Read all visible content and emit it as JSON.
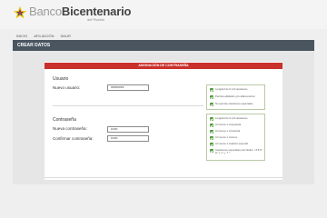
{
  "brand": {
    "name_light": "Banco",
    "name_bold": "Bicentenario",
    "tagline": "del Pueblo",
    "colors": {
      "star_yellow": "#f3c300",
      "star_blue": "#1f4f9a",
      "star_red": "#d32f2f"
    }
  },
  "nav": {
    "items": [
      "INICIO",
      "AFILIACIÓN",
      "SALIR"
    ]
  },
  "header": {
    "title": "CREAR DATOS"
  },
  "panel": {
    "title": "ASIGNACIÓN DE CONTRASEÑA",
    "accent_color": "#c9302c"
  },
  "usuario": {
    "section_title": "Usuario",
    "field_label": "Nuevo usuario:",
    "field_value": "xxxxxxxx",
    "rules": [
      "Longitud de 6 a 8 caracteres",
      "Permite alfabético y/o alfanumérico",
      "No permite caracteres especiales"
    ]
  },
  "contrasena": {
    "section_title": "Contraseña",
    "new_label": "Nueva contraseña:",
    "new_value": "••••••",
    "confirm_label": "Confirmar contraseña:",
    "confirm_value": "••••••",
    "rules": [
      "Longitud de 6 a 8 caracteres",
      "Al menos 1 mayúscula",
      "Al menos 1 minúscula",
      "Al menos 1 número",
      "Al menos 1 carácter especial",
      "Caracteres especiales permitidos: ! # $ % & / ( ) = ¿ ? * -"
    ]
  }
}
